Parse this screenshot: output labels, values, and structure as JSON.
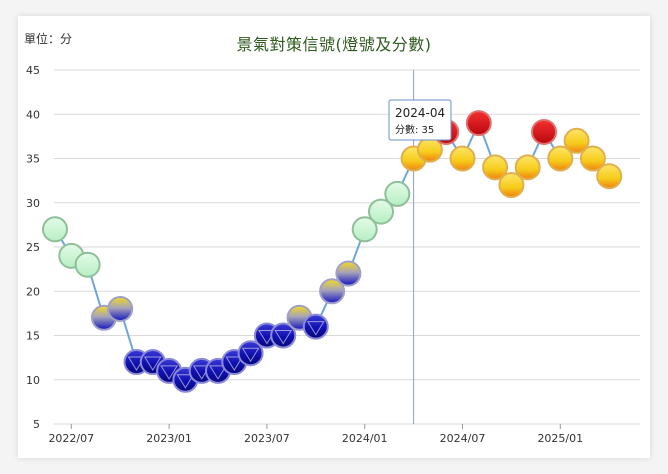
{
  "unit_label": "單位：分",
  "title": "景氣對策信號(燈號及分數)",
  "tooltip": {
    "line1": "2024-04",
    "line2": "分數: 35"
  },
  "colors": {
    "line": "#6fa6dc",
    "grid": "#d9d9d9",
    "blue": "#1010a8",
    "yellow_blue": "#e8d020",
    "green": "#c6f5d0",
    "yellow": "#f6d21a",
    "red": "#d8101a"
  },
  "chart_data": {
    "type": "line",
    "title": "景氣對策信號(燈號及分數)",
    "ylabel": "單位：分",
    "ylim": [
      5,
      45
    ],
    "yticks": [
      5,
      10,
      15,
      20,
      25,
      30,
      35,
      40,
      45
    ],
    "xticks": [
      "2022/07",
      "2023/01",
      "2023/07",
      "2024/01",
      "2024/07",
      "2025/01"
    ],
    "grid": true,
    "highlight": "2024-04",
    "series": [
      {
        "values": [
          {
            "x": "2022-06",
            "y": 27,
            "signal": "green"
          },
          {
            "x": "2022-07",
            "y": 24,
            "signal": "green"
          },
          {
            "x": "2022-08",
            "y": 23,
            "signal": "green"
          },
          {
            "x": "2022-09",
            "y": 17,
            "signal": "yellow-blue"
          },
          {
            "x": "2022-10",
            "y": 18,
            "signal": "yellow-blue"
          },
          {
            "x": "2022-11",
            "y": 12,
            "signal": "blue"
          },
          {
            "x": "2022-12",
            "y": 12,
            "signal": "blue"
          },
          {
            "x": "2023-01",
            "y": 11,
            "signal": "blue"
          },
          {
            "x": "2023-02",
            "y": 10,
            "signal": "blue"
          },
          {
            "x": "2023-03",
            "y": 11,
            "signal": "blue"
          },
          {
            "x": "2023-04",
            "y": 11,
            "signal": "blue"
          },
          {
            "x": "2023-05",
            "y": 12,
            "signal": "blue"
          },
          {
            "x": "2023-06",
            "y": 13,
            "signal": "blue"
          },
          {
            "x": "2023-07",
            "y": 15,
            "signal": "blue"
          },
          {
            "x": "2023-08",
            "y": 15,
            "signal": "blue"
          },
          {
            "x": "2023-09",
            "y": 17,
            "signal": "yellow-blue"
          },
          {
            "x": "2023-10",
            "y": 16,
            "signal": "blue"
          },
          {
            "x": "2023-11",
            "y": 20,
            "signal": "yellow-blue"
          },
          {
            "x": "2023-12",
            "y": 22,
            "signal": "yellow-blue"
          },
          {
            "x": "2024-01",
            "y": 27,
            "signal": "green"
          },
          {
            "x": "2024-02",
            "y": 29,
            "signal": "green"
          },
          {
            "x": "2024-03",
            "y": 31,
            "signal": "green"
          },
          {
            "x": "2024-04",
            "y": 35,
            "signal": "yellow"
          },
          {
            "x": "2024-05",
            "y": 36,
            "signal": "yellow"
          },
          {
            "x": "2024-06",
            "y": 38,
            "signal": "red"
          },
          {
            "x": "2024-07",
            "y": 35,
            "signal": "yellow"
          },
          {
            "x": "2024-08",
            "y": 39,
            "signal": "red"
          },
          {
            "x": "2024-09",
            "y": 34,
            "signal": "yellow"
          },
          {
            "x": "2024-10",
            "y": 32,
            "signal": "yellow"
          },
          {
            "x": "2024-11",
            "y": 34,
            "signal": "yellow"
          },
          {
            "x": "2024-12",
            "y": 38,
            "signal": "red"
          },
          {
            "x": "2025-01",
            "y": 35,
            "signal": "yellow"
          },
          {
            "x": "2025-02",
            "y": 37,
            "signal": "yellow"
          },
          {
            "x": "2025-03",
            "y": 35,
            "signal": "yellow"
          },
          {
            "x": "2025-04",
            "y": 33,
            "signal": "yellow"
          }
        ]
      }
    ]
  }
}
